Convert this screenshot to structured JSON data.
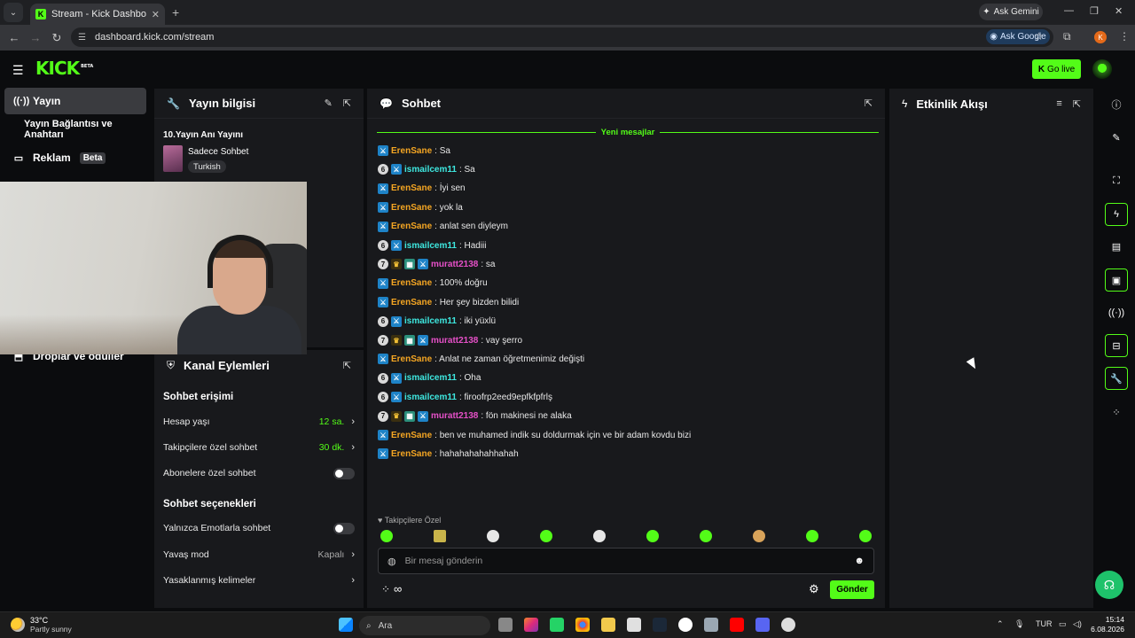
{
  "browser": {
    "tab_title": "Stream - Kick Dashboard",
    "ask_gemini": "Ask Gemini",
    "url": "dashboard.kick.com/stream",
    "ask_google": "Ask Google",
    "profile_initial": "K"
  },
  "header": {
    "logo": "KICK",
    "logo_sup": "BETA",
    "go_live": "Go live"
  },
  "sidebar": {
    "items": [
      {
        "label": "Yayın"
      },
      {
        "label": "Yayın Bağlantısı ve Anahtarı"
      },
      {
        "label": "Reklam",
        "badge": "Beta"
      },
      {
        "label": "Droplar ve ödüller"
      }
    ]
  },
  "yayin_bilgisi": {
    "title": "Yayın bilgisi",
    "stream_title": "10.Yayın Anı Yayını",
    "category": "Sadece Sohbet",
    "language": "Turkish"
  },
  "kanal_eylemleri": {
    "title": "Kanal Eylemleri",
    "section1": "Sohbet erişimi",
    "section2": "Sohbet seçenekleri",
    "rows": [
      {
        "label": "Hesap yaşı",
        "value": "12 sa."
      },
      {
        "label": "Takipçilere özel sohbet",
        "value": "30 dk."
      },
      {
        "label": "Abonelere özel sohbet"
      },
      {
        "label": "Yalnızca Emotlarla sohbet"
      },
      {
        "label": "Yavaş mod",
        "value": "Kapalı"
      },
      {
        "label": "Yasaklanmış kelimeler"
      }
    ]
  },
  "chat": {
    "title": "Sohbet",
    "new_messages": "Yeni mesajlar",
    "messages": [
      {
        "user": "ErenSane",
        "text": ": Sa",
        "color": "#f5a623",
        "badges": [
          "mod"
        ]
      },
      {
        "user": "ismailcem11",
        "text": ": Sa",
        "color": "#3ee8e0",
        "badges": [
          "num6",
          "mod"
        ]
      },
      {
        "user": "ErenSane",
        "text": ": İyi sen",
        "color": "#f5a623",
        "badges": [
          "mod"
        ]
      },
      {
        "user": "ErenSane",
        "text": ": yok la",
        "color": "#f5a623",
        "badges": [
          "mod"
        ]
      },
      {
        "user": "ErenSane",
        "text": ": anlat sen diyleym",
        "color": "#f5a623",
        "badges": [
          "mod"
        ]
      },
      {
        "user": "ismailcem11",
        "text": ": Hadiii",
        "color": "#3ee8e0",
        "badges": [
          "num6",
          "mod"
        ]
      },
      {
        "user": "muratt2138",
        "text": ": sa",
        "color": "#e650c8",
        "badges": [
          "num7",
          "crown",
          "sub",
          "mod"
        ]
      },
      {
        "user": "ErenSane",
        "text": ": 100% doğru",
        "color": "#f5a623",
        "badges": [
          "mod"
        ]
      },
      {
        "user": "ErenSane",
        "text": ": Her şey bizden bilidi",
        "color": "#f5a623",
        "badges": [
          "mod"
        ]
      },
      {
        "user": "ismailcem11",
        "text": ": iki yüxlü",
        "color": "#3ee8e0",
        "badges": [
          "num6",
          "mod"
        ]
      },
      {
        "user": "muratt2138",
        "text": ": vay şerro",
        "color": "#e650c8",
        "badges": [
          "num7",
          "crown",
          "sub",
          "mod"
        ]
      },
      {
        "user": "ErenSane",
        "text": ": Anlat ne zaman öğretmenimiz değişti",
        "color": "#f5a623",
        "badges": [
          "mod"
        ]
      },
      {
        "user": "ismailcem11",
        "text": ": Oha",
        "color": "#3ee8e0",
        "badges": [
          "num6",
          "mod"
        ]
      },
      {
        "user": "ismailcem11",
        "text": ": firoofrp2eed9epfkfpfrlş",
        "color": "#3ee8e0",
        "badges": [
          "num6",
          "mod"
        ]
      },
      {
        "user": "muratt2138",
        "text": ": fön makinesi ne alaka",
        "color": "#e650c8",
        "badges": [
          "num7",
          "crown",
          "sub",
          "mod"
        ]
      },
      {
        "user": "ErenSane",
        "text": ": ben ve muhamed indik su doldurmak için ve bir adam kovdu bizi",
        "color": "#f5a623",
        "badges": [
          "mod"
        ]
      },
      {
        "user": "ErenSane",
        "text": ": hahahahahahhahah",
        "color": "#f5a623",
        "badges": [
          "mod"
        ]
      }
    ],
    "followers_only_label": "Takipçilere Özel",
    "input_placeholder": "Bir mesaj gönderin",
    "send": "Gönder",
    "infinity": "∞"
  },
  "activity": {
    "title": "Etkinlik Akışı"
  },
  "taskbar": {
    "temp": "33°C",
    "weather": "Partly sunny",
    "search": "Ara",
    "lang": "TUR",
    "time": "15:14",
    "date": "6.08.2026"
  },
  "colors": {
    "accent": "#53fc18",
    "panel": "#18191c",
    "bg": "#0b0c0e"
  }
}
